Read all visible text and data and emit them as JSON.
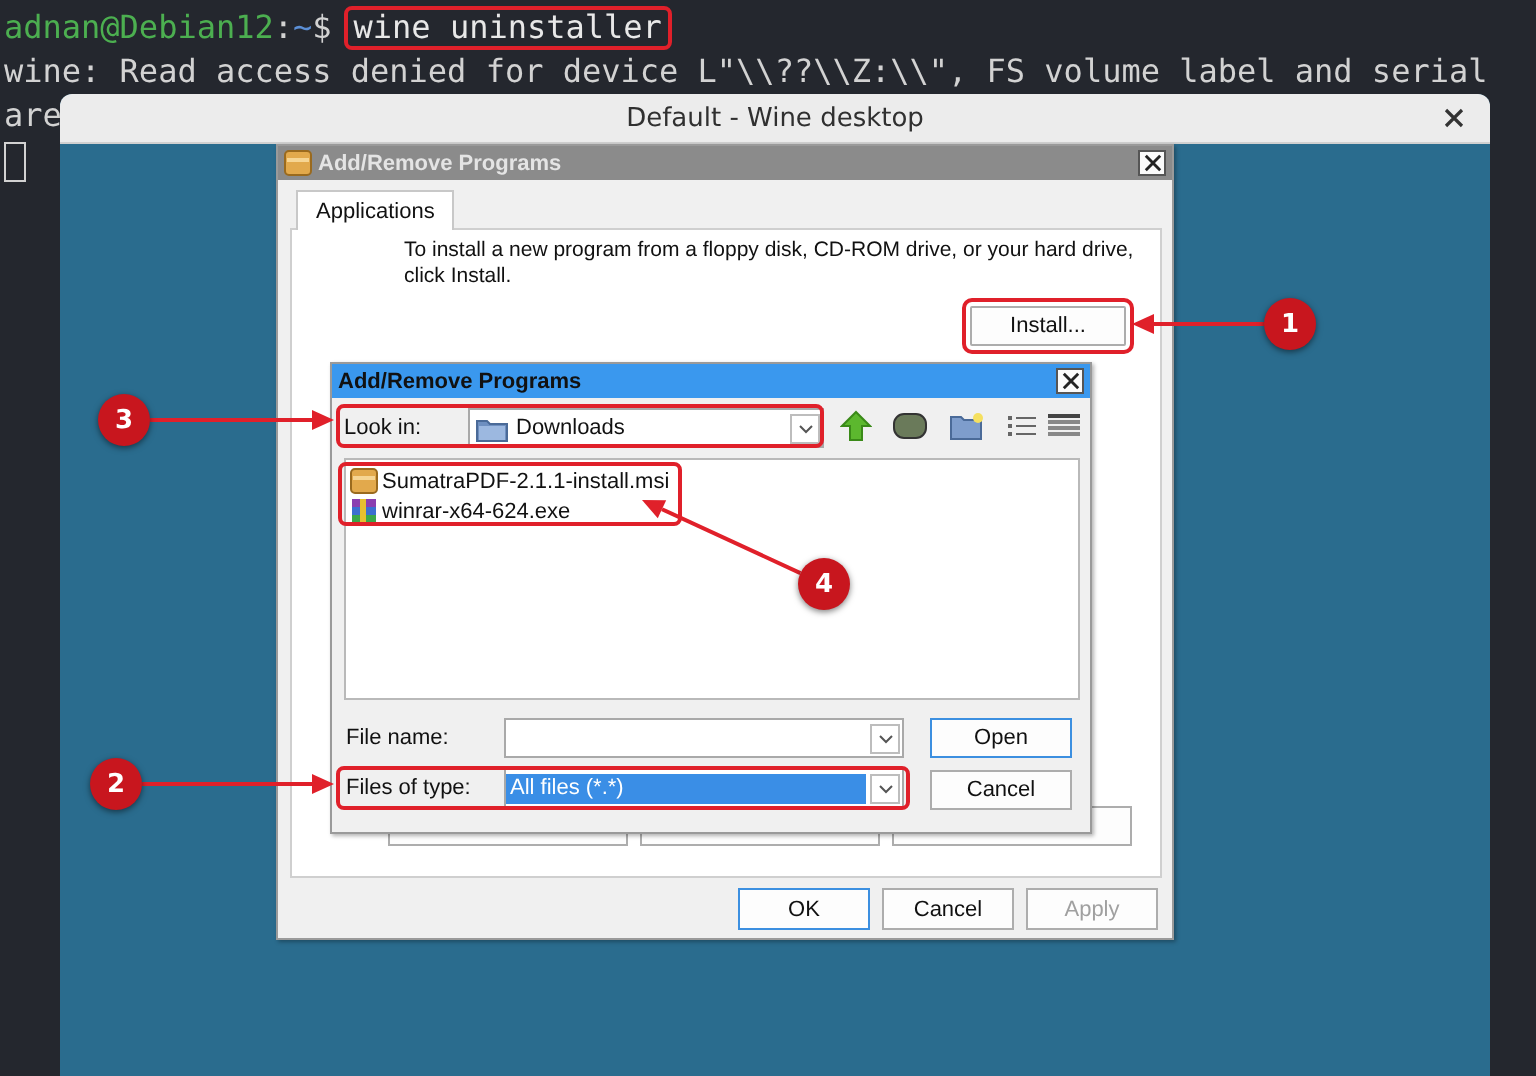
{
  "terminal": {
    "prompt": [
      {
        "text": "adnan@Debian12",
        "kind": "user"
      },
      {
        "text": ":",
        "kind": "plain"
      },
      {
        "text": "~",
        "kind": "path"
      },
      {
        "text": "$",
        "kind": "plain"
      }
    ],
    "command": "wine uninstaller",
    "output_lines": [
      "wine: Read access denied for device L\"\\\\??\\\\Z:\\\\\", FS volume label and serial",
      "are"
    ]
  },
  "wine_window": {
    "title": "Default - Wine desktop"
  },
  "programs_dialog": {
    "title": "Add/Remove Programs",
    "active": false,
    "tabs": [
      {
        "label": "Applications",
        "selected": true
      }
    ],
    "instructions": "To install a new program from a floppy disk, CD-ROM drive, or your hard drive, click Install.",
    "install_button": "Install...",
    "buttons": [
      {
        "label": "OK",
        "default": true,
        "disabled": false
      },
      {
        "label": "Cancel",
        "default": false,
        "disabled": false
      },
      {
        "label": "Apply",
        "default": false,
        "disabled": true
      }
    ]
  },
  "file_dialog": {
    "title": "Add/Remove Programs",
    "active": true,
    "look_in": {
      "label": "Look in:",
      "value": "Downloads"
    },
    "files": [
      {
        "name": "SumatraPDF-2.1.1-install.msi",
        "kind": "msi"
      },
      {
        "name": "winrar-x64-624.exe",
        "kind": "exe"
      }
    ],
    "file_name": {
      "label": "File name:"
    },
    "files_of_type": {
      "label": "Files of type:",
      "value": "All files (*.*)",
      "value_selected": true
    },
    "buttons": [
      {
        "label": "Open",
        "default": true
      },
      {
        "label": "Cancel",
        "default": false
      }
    ]
  },
  "callouts": [
    {
      "number": "1"
    },
    {
      "number": "2"
    },
    {
      "number": "3"
    },
    {
      "number": "4"
    }
  ]
}
